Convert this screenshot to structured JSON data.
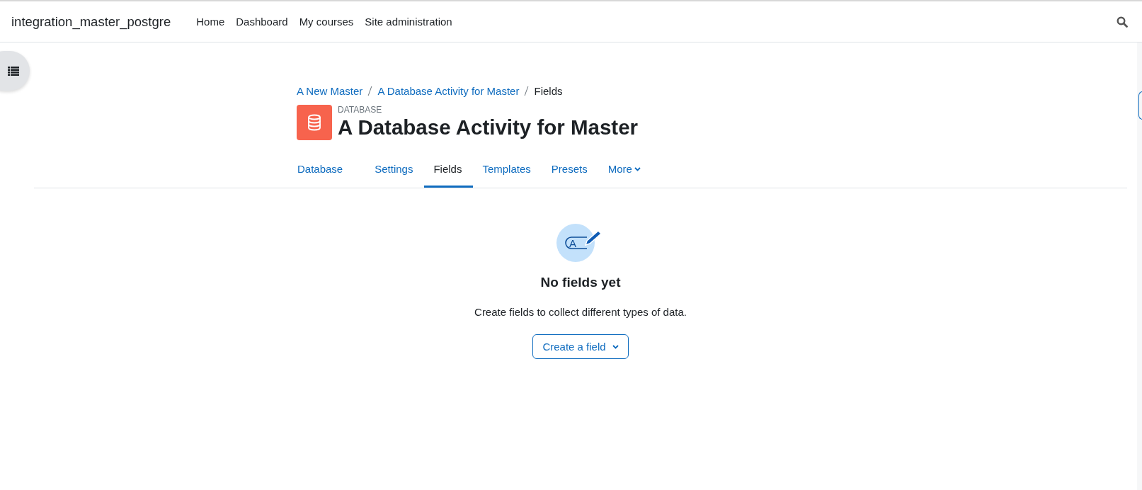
{
  "navbar": {
    "site_name": "integration_master_postgre",
    "links": [
      {
        "label": "Home"
      },
      {
        "label": "Dashboard"
      },
      {
        "label": "My courses"
      },
      {
        "label": "Site administration"
      }
    ]
  },
  "breadcrumb": [
    {
      "label": "A New Master",
      "kind": "link"
    },
    {
      "label": "A Database Activity for Master",
      "kind": "link"
    },
    {
      "label": "Fields",
      "kind": "current"
    }
  ],
  "header": {
    "module_type": "DATABASE",
    "title": "A Database Activity for Master"
  },
  "tabs": [
    {
      "label": "Database",
      "selected": false,
      "kind": "tab"
    },
    {
      "label": "Settings",
      "selected": false,
      "kind": "tab"
    },
    {
      "label": "Fields",
      "selected": true,
      "kind": "tab"
    },
    {
      "label": "Templates",
      "selected": false,
      "kind": "tab"
    },
    {
      "label": "Presets",
      "selected": false,
      "kind": "tab"
    },
    {
      "label": "More",
      "selected": false,
      "kind": "dropdown"
    }
  ],
  "empty_state": {
    "icon_letter": "A",
    "heading": "No fields yet",
    "message": "Create fields to collect different types of data.",
    "button": "Create a field"
  }
}
